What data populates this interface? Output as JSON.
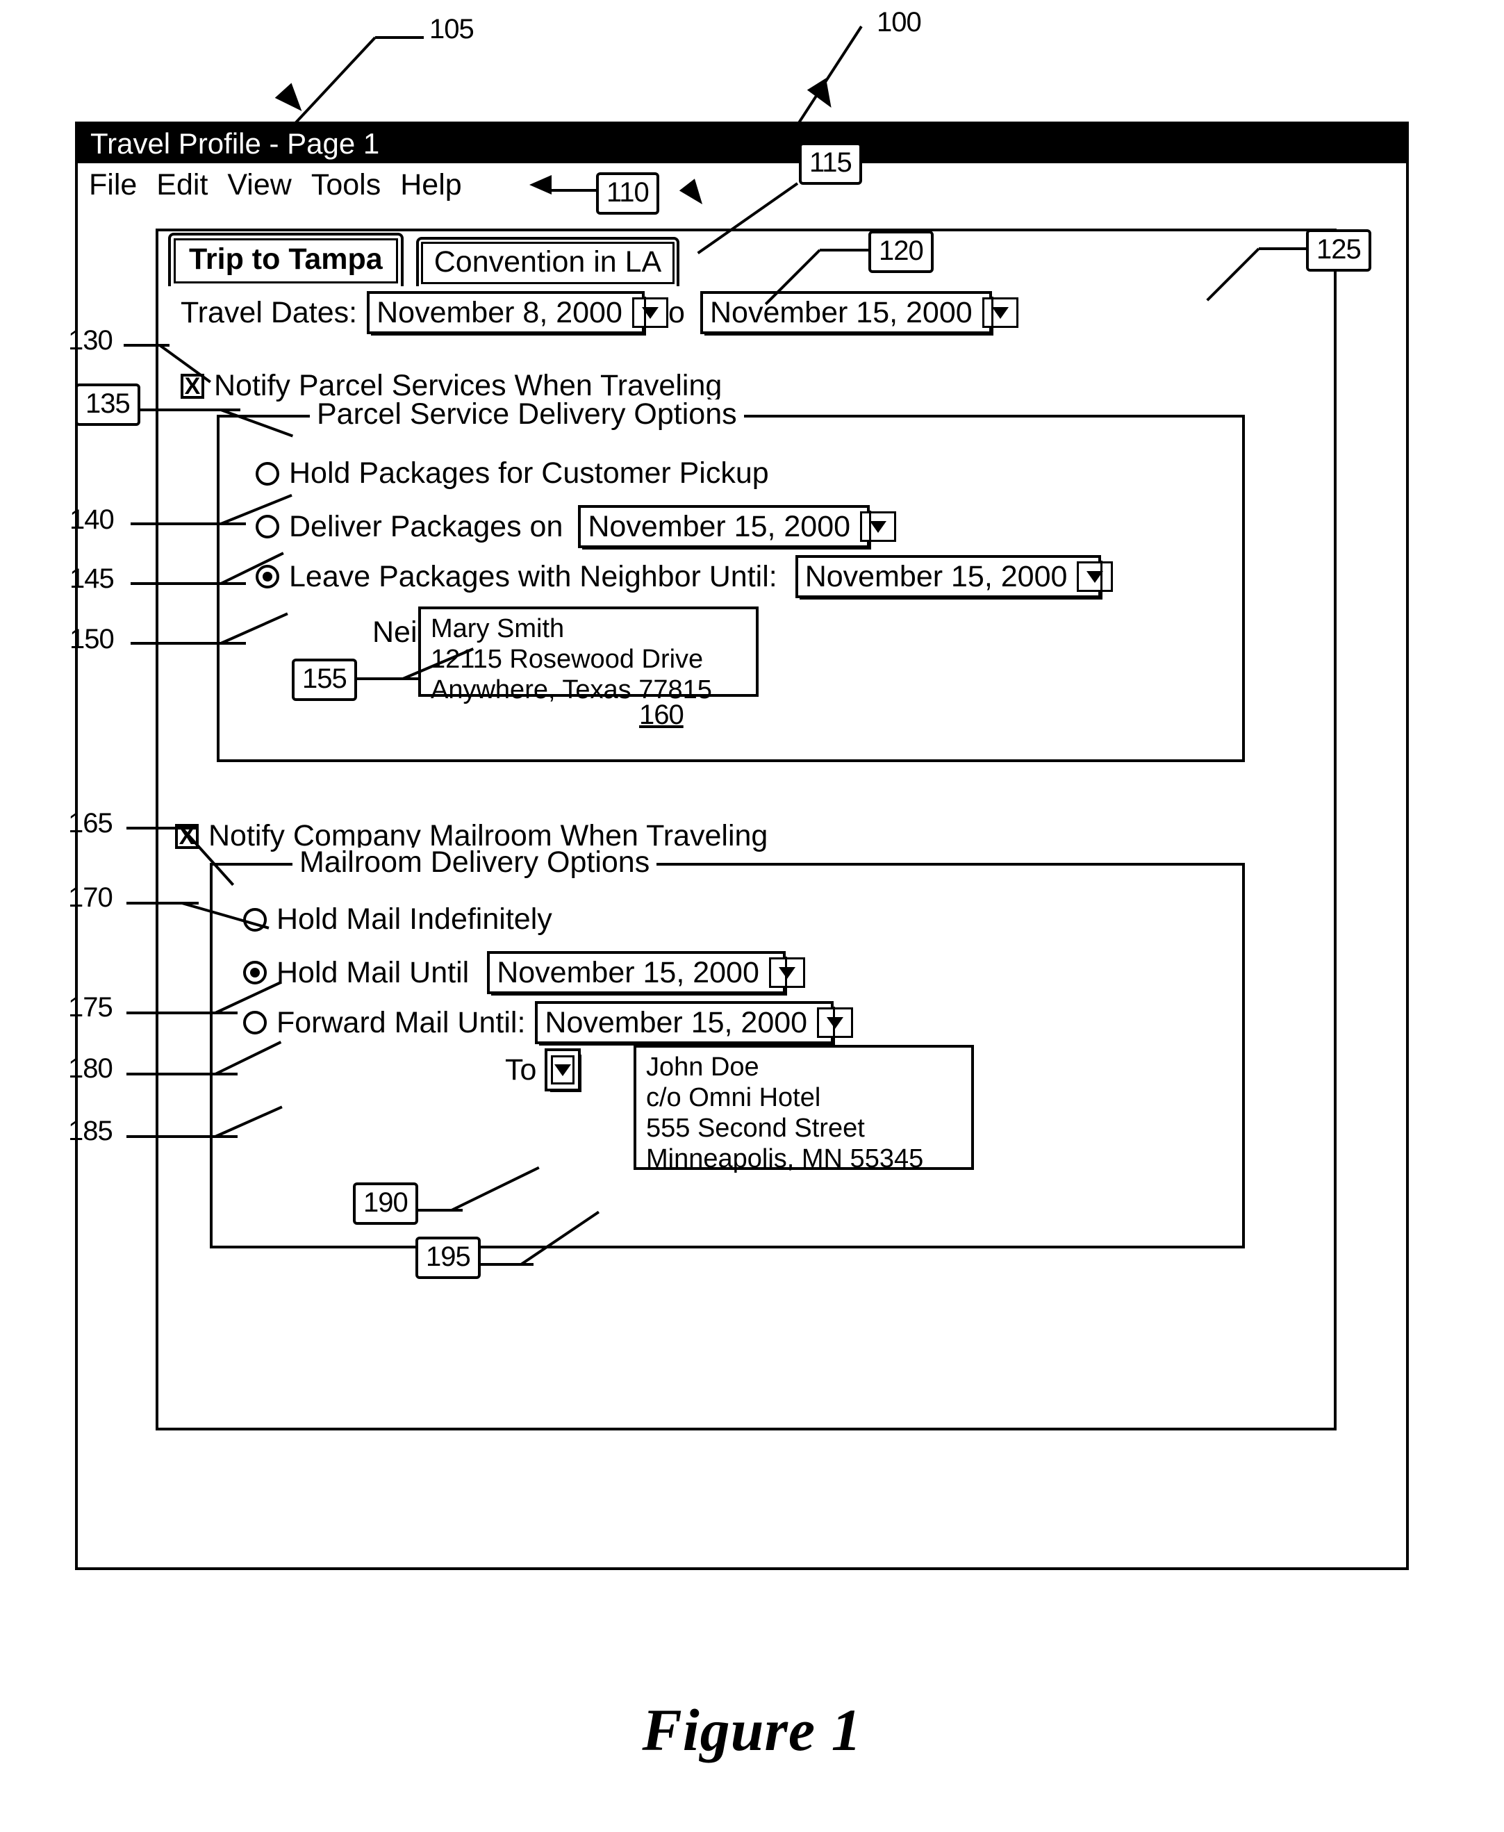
{
  "figure": {
    "caption": "Figure 1"
  },
  "callouts": {
    "window_outer": "100",
    "titlebar": "105",
    "menubar": "110",
    "tabs": "115",
    "date_from": "120",
    "date_to": "125",
    "notify_parcel_checkbox": "130",
    "parcel_group": "135",
    "hold_packages_radio": "140",
    "deliver_packages_radio": "145",
    "leave_packages_radio": "150",
    "neighbor_dropdown": "155",
    "neighbor_address_box": "160",
    "notify_mailroom_checkbox": "165",
    "mailroom_group": "170",
    "hold_mail_indefinitely_radio": "175",
    "hold_mail_until_radio": "180",
    "forward_mail_radio": "185",
    "to_dropdown": "190",
    "to_address_box": "195"
  },
  "window": {
    "title": "Travel Profile - Page 1",
    "menu": [
      "File",
      "Edit",
      "View",
      "Tools",
      "Help"
    ]
  },
  "tabs": [
    {
      "label": "Trip to Tampa",
      "active": true
    },
    {
      "label": "Convention in LA",
      "active": false
    }
  ],
  "travel_dates": {
    "label": "Travel Dates:",
    "from_value": "November 8, 2000",
    "separator": "to",
    "to_value": "November 15, 2000"
  },
  "parcel": {
    "notify_label": "Notify Parcel Services When Traveling",
    "notify_checked": true,
    "checkbox_mark": "X",
    "group_legend": "Parcel Service Delivery Options",
    "options": [
      {
        "label": "Hold Packages for Customer Pickup",
        "selected": false
      },
      {
        "label": "Deliver Packages on",
        "selected": false,
        "date_value": "November 15, 2000"
      },
      {
        "label": "Leave Packages with Neighbor Until:",
        "selected": true,
        "date_value": "November 15, 2000"
      }
    ],
    "neighbor_label": "Neighbor",
    "neighbor_address": [
      "Mary Smith",
      "12115 Rosewood Drive",
      "Anywhere, Texas  77815"
    ]
  },
  "mailroom": {
    "notify_label": "Notify Company Mailroom When Traveling",
    "notify_checked": true,
    "checkbox_mark": "X",
    "group_legend": "Mailroom Delivery Options",
    "options": [
      {
        "label": "Hold Mail Indefinitely",
        "selected": false
      },
      {
        "label": "Hold Mail Until",
        "selected": true,
        "date_value": "November 15, 2000"
      },
      {
        "label": "Forward Mail Until:",
        "selected": false,
        "date_value": "November 15, 2000"
      }
    ],
    "to_label": "To",
    "to_address": [
      "John Doe",
      "c/o Omni Hotel",
      "555 Second Street",
      "Minneapolis, MN  55345"
    ]
  }
}
